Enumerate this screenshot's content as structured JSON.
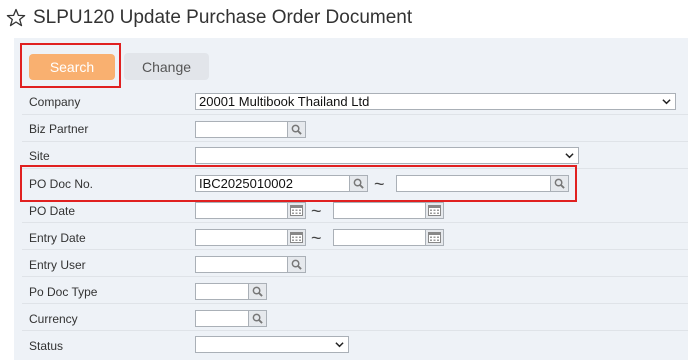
{
  "page": {
    "title": "SLPU120 Update Purchase Order Document"
  },
  "buttons": {
    "search": "Search",
    "change": "Change"
  },
  "form": {
    "company": {
      "label": "Company",
      "value": "20001 Multibook Thailand Ltd"
    },
    "biz_partner": {
      "label": "Biz Partner",
      "value": ""
    },
    "site": {
      "label": "Site",
      "value": ""
    },
    "po_doc_no": {
      "label": "PO Doc No.",
      "from": "IBC2025010002",
      "to": ""
    },
    "po_date": {
      "label": "PO Date",
      "from": "",
      "to": ""
    },
    "entry_date": {
      "label": "Entry Date",
      "from": "",
      "to": ""
    },
    "entry_user": {
      "label": "Entry User",
      "value": ""
    },
    "po_doc_type": {
      "label": "Po Doc Type",
      "value": ""
    },
    "currency": {
      "label": "Currency",
      "value": ""
    },
    "status": {
      "label": "Status",
      "value": ""
    }
  },
  "range_separator": "~",
  "colors": {
    "search_button": "#f9b070",
    "highlight": "#e02020",
    "panel": "#eef2f7"
  },
  "icons": [
    "star-icon",
    "magnifier-icon",
    "calendar-icon",
    "chevron-down-icon"
  ]
}
